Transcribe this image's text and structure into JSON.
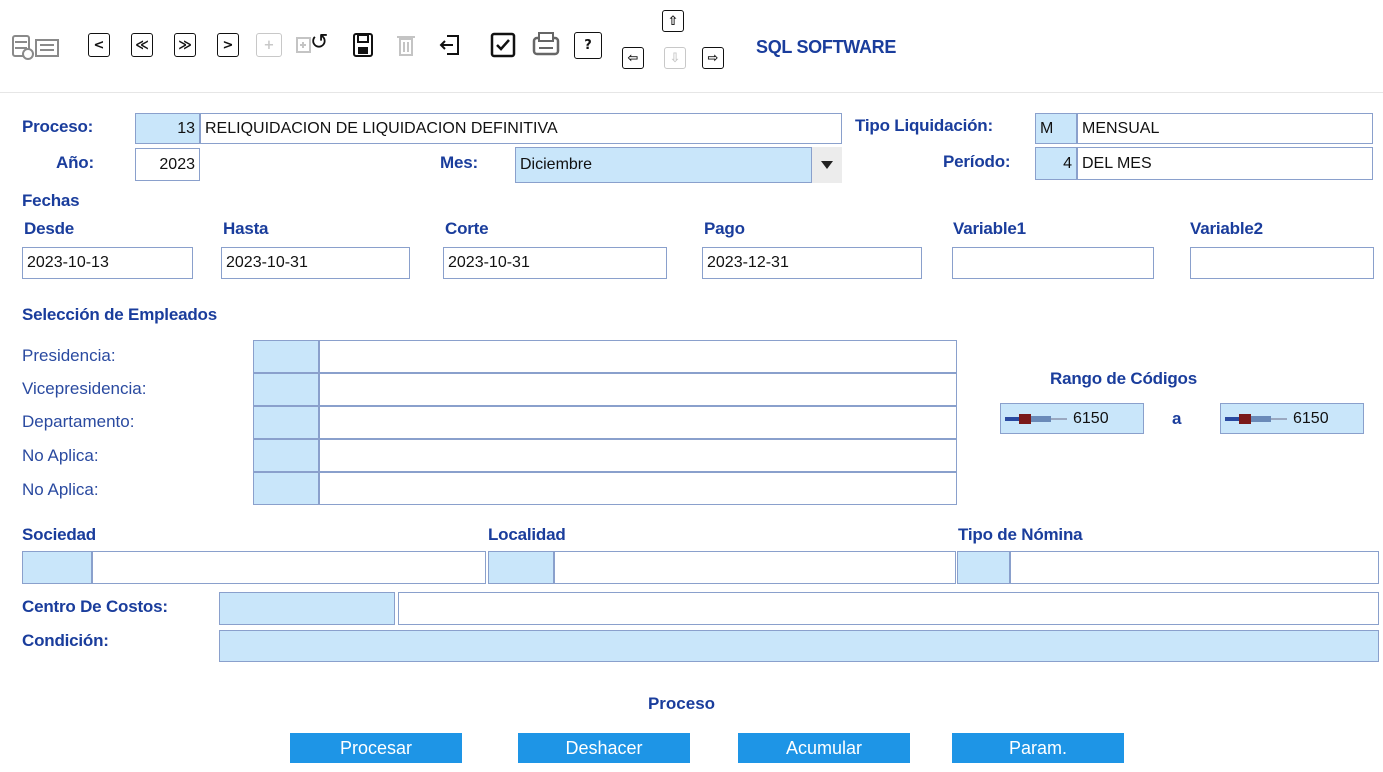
{
  "app": {
    "brand": "SQL SOFTWARE"
  },
  "toolbar": {
    "icons": [
      "database-list-icon",
      "prev-icon",
      "first-icon",
      "last-icon",
      "next-icon",
      "add-icon",
      "new-doc-icon",
      "undo-icon",
      "save-icon",
      "delete-icon",
      "exit-icon",
      "check-icon",
      "print-icon",
      "help-icon",
      "arrow-up-icon",
      "arrow-left-icon",
      "arrow-down-icon",
      "arrow-right-icon"
    ],
    "prev_glyph": "<",
    "first_glyph": "≪",
    "last_glyph": "≫",
    "next_glyph": ">",
    "help_glyph": "?",
    "undo_glyph": "↺",
    "add_glyph": "+",
    "up_glyph": "⇧",
    "left_glyph": "⇦",
    "down_glyph": "⇩",
    "right_glyph": "⇨"
  },
  "form": {
    "proceso": {
      "label": "Proceso:",
      "code": "13",
      "name": "RELIQUIDACION DE LIQUIDACION DEFINITIVA"
    },
    "tipo_liquidacion": {
      "label": "Tipo Liquidación:",
      "code": "M",
      "name": "MENSUAL"
    },
    "anio": {
      "label": "Año:",
      "value": "2023"
    },
    "mes": {
      "label": "Mes:",
      "value": "Diciembre"
    },
    "periodo": {
      "label": "Período:",
      "code": "4",
      "name": "DEL MES"
    },
    "fechas": {
      "title": "Fechas",
      "desde": {
        "label": "Desde",
        "value": "2023-10-13"
      },
      "hasta": {
        "label": "Hasta",
        "value": "2023-10-31"
      },
      "corte": {
        "label": "Corte",
        "value": "2023-10-31"
      },
      "pago": {
        "label": "Pago",
        "value": "2023-12-31"
      },
      "variable1": {
        "label": "Variable1",
        "value": ""
      },
      "variable2": {
        "label": "Variable2",
        "value": ""
      }
    },
    "seleccion": {
      "title": "Selección de Empleados",
      "rows": [
        {
          "label": "Presidencia:"
        },
        {
          "label": "Vicepresidencia:"
        },
        {
          "label": "Departamento:"
        },
        {
          "label": "No Aplica:"
        },
        {
          "label": "No Aplica:"
        }
      ]
    },
    "rango": {
      "title": "Rango de Códigos",
      "from": "6150",
      "sep": "a",
      "to": "6150"
    },
    "sociedad": {
      "label": "Sociedad"
    },
    "localidad": {
      "label": "Localidad"
    },
    "tipo_nomina": {
      "label": "Tipo de Nómina"
    },
    "centro_costos": {
      "label": "Centro De Costos:"
    },
    "condicion": {
      "label": "Condición:"
    }
  },
  "proceso_section": {
    "title": "Proceso",
    "buttons": [
      "Procesar",
      "Deshacer",
      "Acumular",
      "Param."
    ]
  },
  "colors": {
    "label_blue": "#1a3d9c",
    "field_blue": "#c9e6fa",
    "button_blue": "#1e95e6",
    "field_border": "#8aa0cc"
  }
}
